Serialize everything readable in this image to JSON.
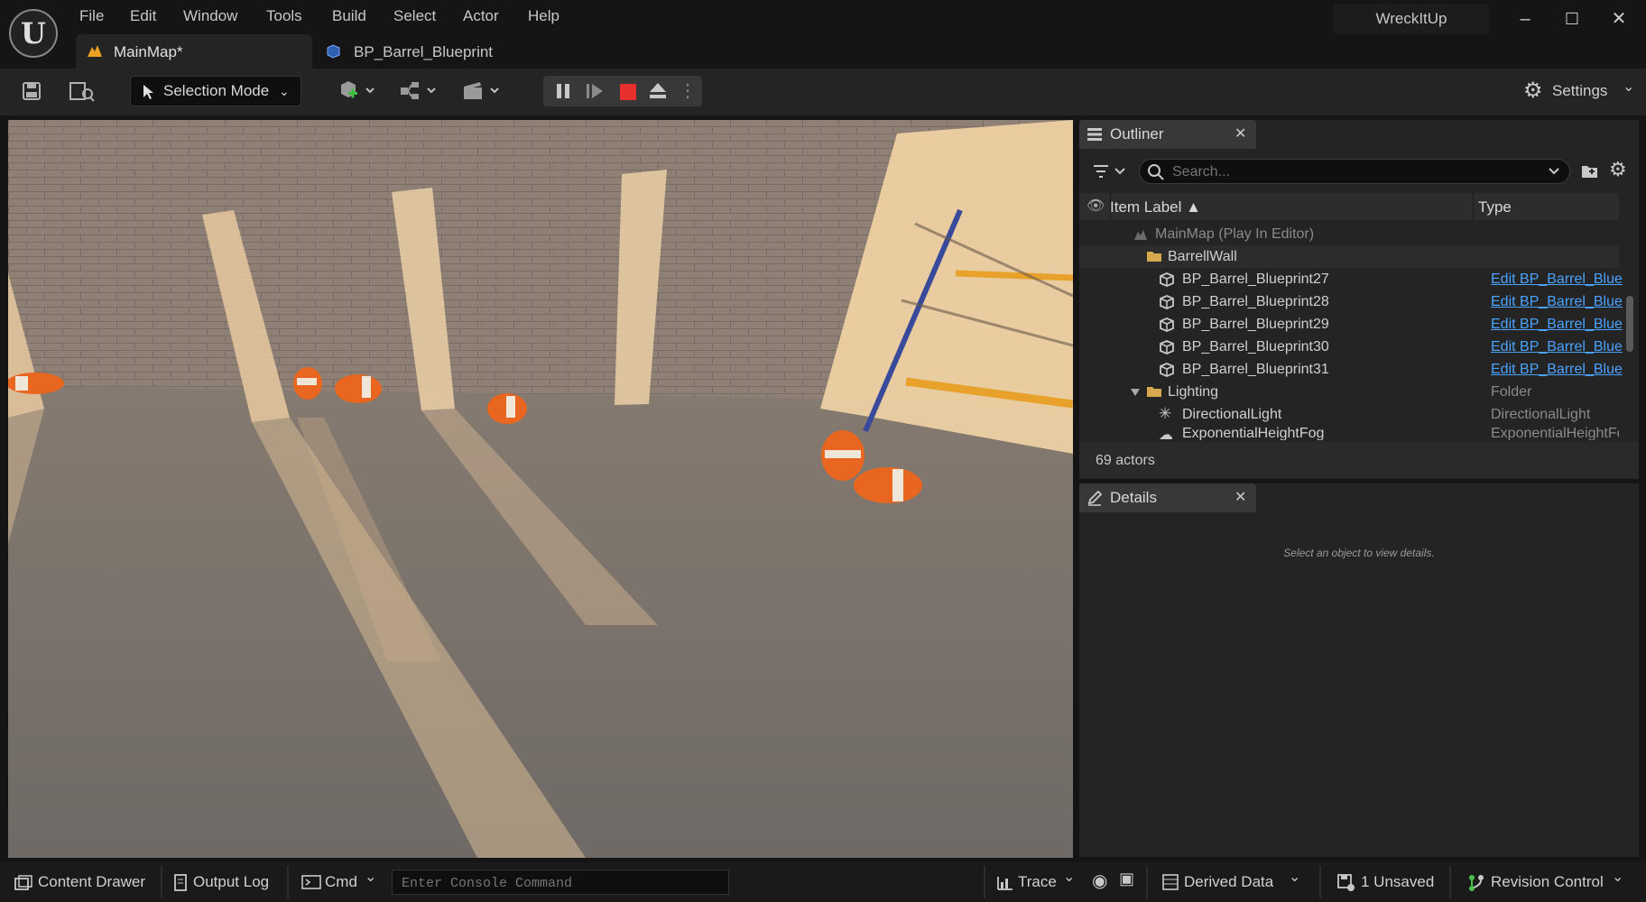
{
  "menu": [
    "File",
    "Edit",
    "Window",
    "Tools",
    "Build",
    "Select",
    "Actor",
    "Help"
  ],
  "project_name": "WreckItUp",
  "window_buttons": [
    "–",
    "☐",
    "✕"
  ],
  "tabs": [
    {
      "label": "MainMap*",
      "active": true
    },
    {
      "label": "BP_Barrel_Blueprint",
      "active": false
    }
  ],
  "toolbar": {
    "selection_mode": "Selection Mode",
    "settings": "Settings"
  },
  "outliner": {
    "title": "Outliner",
    "search_placeholder": "Search...",
    "col_label": "Item Label ▲",
    "col_type": "Type",
    "rows": [
      {
        "label": "MainMap (Play In Editor)",
        "type": ""
      },
      {
        "label": "BarrellWall",
        "type": ""
      },
      {
        "label": "BP_Barrel_Blueprint27",
        "type": "Edit BP_Barrel_Blue"
      },
      {
        "label": "BP_Barrel_Blueprint28",
        "type": "Edit BP_Barrel_Blue"
      },
      {
        "label": "BP_Barrel_Blueprint29",
        "type": "Edit BP_Barrel_Blue"
      },
      {
        "label": "BP_Barrel_Blueprint30",
        "type": "Edit BP_Barrel_Blue"
      },
      {
        "label": "BP_Barrel_Blueprint31",
        "type": "Edit BP_Barrel_Blue"
      },
      {
        "label": "Lighting",
        "type": "Folder"
      },
      {
        "label": "DirectionalLight",
        "type": "DirectionalLight"
      },
      {
        "label": "ExponentialHeightFog",
        "type": "ExponentialHeightFog"
      }
    ],
    "actor_count": "69 actors"
  },
  "details": {
    "title": "Details",
    "empty_message": "Select an object to view details."
  },
  "statusbar": {
    "content_drawer": "Content Drawer",
    "output_log": "Output Log",
    "cmd": "Cmd",
    "console_placeholder": "Enter Console Command",
    "trace": "Trace",
    "derived_data": "Derived Data",
    "unsaved": "1 Unsaved",
    "revision_control": "Revision Control"
  },
  "colors": {
    "accent_blue": "#4aa3ff",
    "stop_red": "#e8312f",
    "barrel_orange": "#e8661f"
  }
}
